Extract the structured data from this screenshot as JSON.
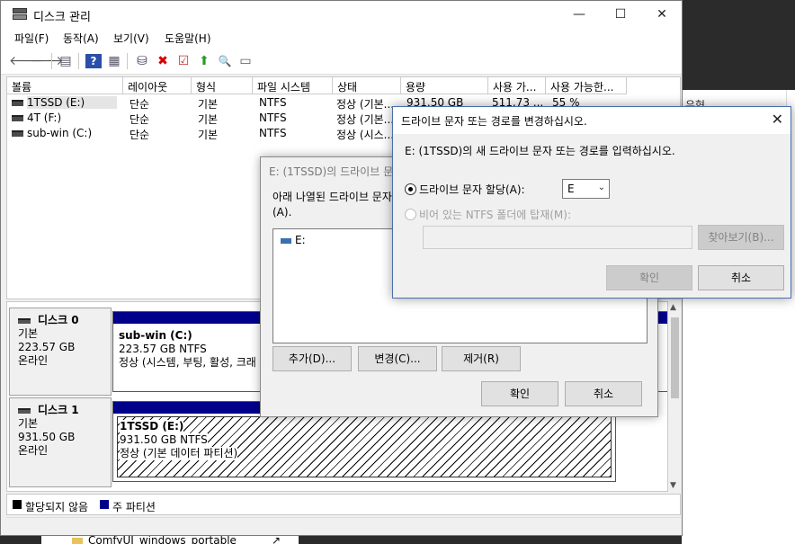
{
  "background": {
    "right_header": "유형",
    "bottom_item": "ComfyUI_windows_portable",
    "bottom_arrow": "↗"
  },
  "window": {
    "title": "디스크 관리",
    "controls": {
      "minimize": "—",
      "maximize": "☐",
      "close": "✕"
    }
  },
  "menu": [
    "파일(F)",
    "동작(A)",
    "보기(V)",
    "도움말(H)"
  ],
  "toolbar": {
    "back": "🡐",
    "forward": "🡒",
    "properties": "▤",
    "help": "?",
    "view": "▦",
    "connect": "⛁",
    "delete": "✖",
    "check": "☑",
    "up": "⬆",
    "search": "🔍",
    "settings": "▭"
  },
  "volume_list": {
    "columns": [
      "볼륨",
      "레이아웃",
      "형식",
      "파일 시스템",
      "상태",
      "용량",
      "사용 가...",
      "사용 가능한..."
    ],
    "rows": [
      [
        "1TSSD (E:)",
        "단순",
        "기본",
        "NTFS",
        "정상 (기본...",
        "931.50 GB",
        "511.73 ...",
        "55 %"
      ],
      [
        "4T (F:)",
        "단순",
        "기본",
        "NTFS",
        "정상 (기본...",
        "",
        "",
        ""
      ],
      [
        "sub-win (C:)",
        "단순",
        "기본",
        "NTFS",
        "정상 (시스...",
        "",
        "",
        ""
      ]
    ]
  },
  "disks": [
    {
      "name": "디스크 0",
      "type": "기본",
      "size": "223.57 GB",
      "status": "온라인",
      "partition": {
        "label": "sub-win  (C:)",
        "info": "223.57 GB NTFS",
        "state": "정상 (시스템, 부팅, 활성, 크래"
      }
    },
    {
      "name": "디스크 1",
      "type": "기본",
      "size": "931.50 GB",
      "status": "온라인",
      "partition": {
        "label": "1TSSD  (E:)",
        "info": "931.50 GB NTFS",
        "state": "정상 (기본 데이터 파티션)"
      }
    }
  ],
  "legend": [
    {
      "label": "할당되지 않음",
      "color": "#000000"
    },
    {
      "label": "주 파티션",
      "color": "#00008b"
    }
  ],
  "dialog_paths": {
    "title": "E: (1TSSD)의 드라이브 문",
    "description_line1": "아래 나열된 드라이브 문자",
    "description_line2": "(A).",
    "list_item": "E:",
    "add": "추가(D)...",
    "change": "변경(C)...",
    "remove": "제거(R)",
    "ok": "확인",
    "cancel": "취소"
  },
  "dialog_change": {
    "title": "드라이브 문자 또는 경로를 변경하십시오.",
    "prompt": "E: (1TSSD)의 새 드라이브 문자 또는 경로를 입력하십시오.",
    "assign_label": "드라이브 문자 할당(A):",
    "assign_value": "E",
    "mount_label": "비어 있는 NTFS 폴더에 탑재(M):",
    "path_value": "",
    "browse": "찾아보기(B)...",
    "ok": "확인",
    "cancel": "취소",
    "close": "✕"
  }
}
